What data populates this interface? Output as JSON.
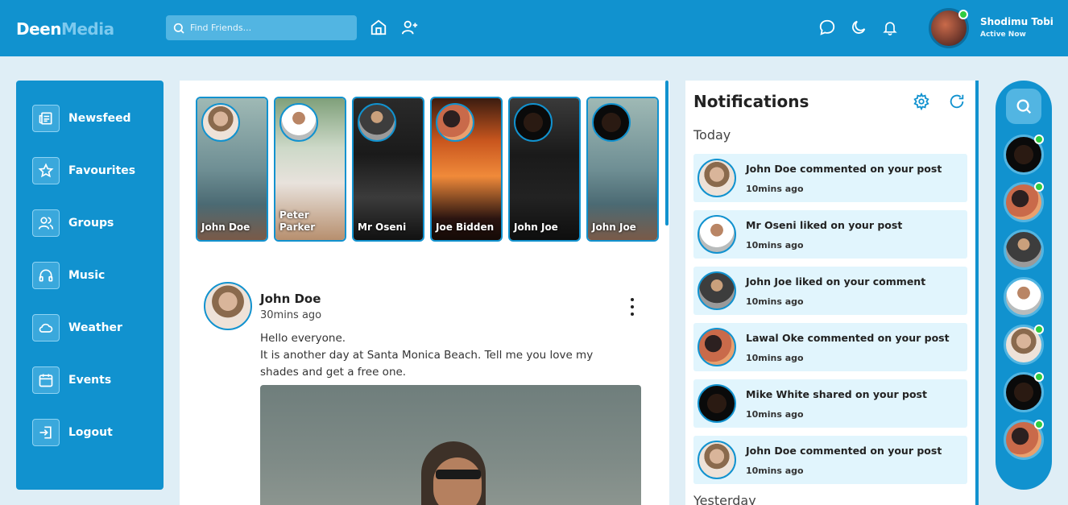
{
  "app": {
    "name_part1": "Deen",
    "name_part2": "Media"
  },
  "search": {
    "placeholder": "Find Friends..."
  },
  "header": {
    "icons": [
      "home-icon",
      "add-user-icon",
      "chat-icon",
      "moon-icon",
      "bell-icon"
    ],
    "user": {
      "name": "Shodimu Tobi",
      "status": "Active Now"
    }
  },
  "sidebar": {
    "items": [
      {
        "label": "Newsfeed",
        "icon": "newspaper-icon"
      },
      {
        "label": "Favourites",
        "icon": "star-icon"
      },
      {
        "label": "Groups",
        "icon": "users-icon"
      },
      {
        "label": "Music",
        "icon": "headphones-icon"
      },
      {
        "label": "Weather",
        "icon": "cloud-icon"
      },
      {
        "label": "Events",
        "icon": "calendar-icon"
      },
      {
        "label": "Logout",
        "icon": "logout-icon"
      }
    ]
  },
  "stories": [
    {
      "name": "John Doe"
    },
    {
      "name": "Peter Parker"
    },
    {
      "name": "Mr Oseni"
    },
    {
      "name": "Joe Bidden"
    },
    {
      "name": "John Joe"
    },
    {
      "name": "John Joe"
    }
  ],
  "post": {
    "author": "John Doe",
    "time": "30mins ago",
    "line1": "Hello everyone.",
    "line2": "It is another day at Santa Monica Beach. Tell me you love my shades and get a free one."
  },
  "notifications": {
    "title": "Notifications",
    "today_label": "Today",
    "yesterday_label": "Yesterday",
    "items": [
      {
        "text": "John Doe commented on your post",
        "time": "10mins ago"
      },
      {
        "text": "Mr Oseni liked on your post",
        "time": "10mins ago"
      },
      {
        "text": "John Joe liked on your comment",
        "time": "10mins ago"
      },
      {
        "text": "Lawal Oke commented on your post",
        "time": "10mins ago"
      },
      {
        "text": "Mike White shared on your post",
        "time": "10mins ago"
      },
      {
        "text": "John Doe commented on your post",
        "time": "10mins ago"
      }
    ]
  },
  "colors": {
    "brand": "#1192cf",
    "accent": "#7cc9ee",
    "online": "#2ecc40"
  }
}
